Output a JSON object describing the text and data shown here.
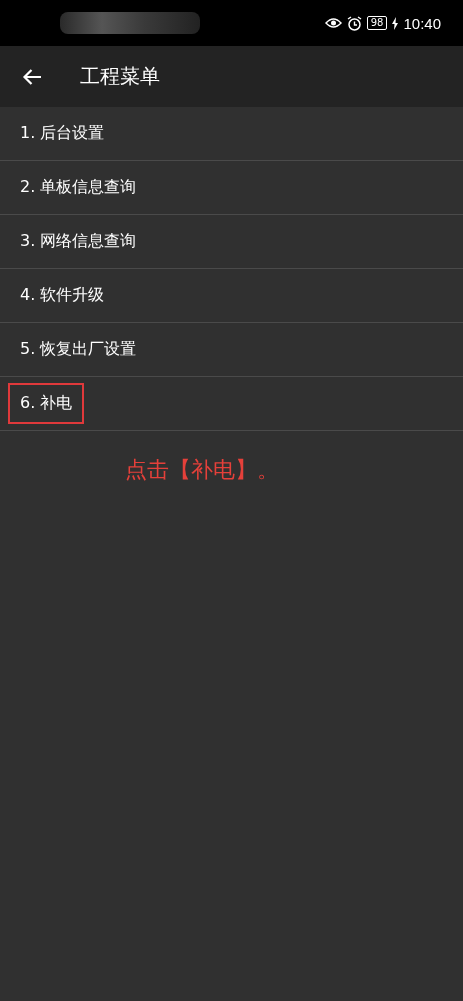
{
  "status_bar": {
    "battery": "98",
    "time": "10:40"
  },
  "app_bar": {
    "title": "工程菜单"
  },
  "menu_items": [
    {
      "label": "1. 后台设置",
      "highlighted": false
    },
    {
      "label": "2. 单板信息查询",
      "highlighted": false
    },
    {
      "label": "3. 网络信息查询",
      "highlighted": false
    },
    {
      "label": "4. 软件升级",
      "highlighted": false
    },
    {
      "label": "5. 恢复出厂设置",
      "highlighted": false
    },
    {
      "label": "6. 补电",
      "highlighted": true
    }
  ],
  "annotation": "点击【补电】。"
}
